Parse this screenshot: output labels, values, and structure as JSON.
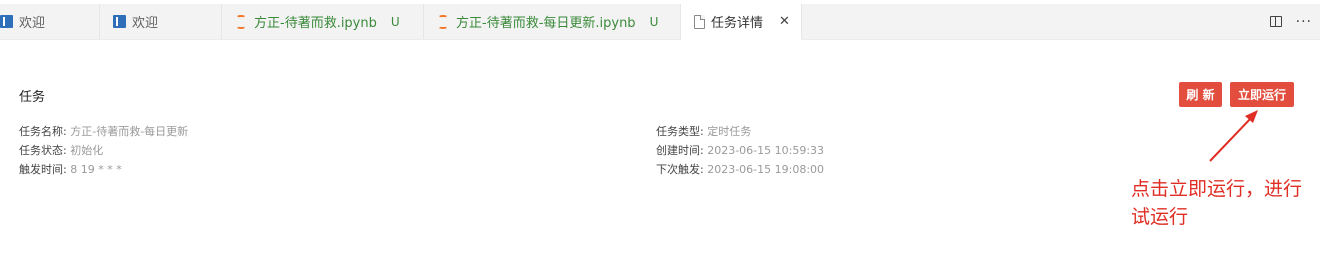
{
  "tabs": [
    {
      "label": "欢迎",
      "icon": "welcome-icon"
    },
    {
      "label": "欢迎",
      "icon": "welcome-icon"
    },
    {
      "label": "方正-待著而救.ipynb",
      "icon": "jupyter-notebook-icon",
      "status": "U"
    },
    {
      "label": "方正-待著而救-每日更新.ipynb",
      "icon": "jupyter-notebook-icon",
      "status": "U"
    },
    {
      "label": "任务详情",
      "icon": "file-icon",
      "close": "✕",
      "active": true
    }
  ],
  "editor_actions": {
    "split": "split-editor-icon",
    "more": "···"
  },
  "task": {
    "section_title": "任务",
    "refresh_label": "刷 新",
    "run_label": "立即运行",
    "name_label": "任务名称:",
    "name_value": "方正-待著而救-每日更新",
    "status_label": "任务状态:",
    "status_value": "初始化",
    "trigger_label": "触发时间:",
    "trigger_value": "8 19 * * *",
    "type_label": "任务类型:",
    "type_value": "定时任务",
    "created_label": "创建时间:",
    "created_value": "2023-06-15 10:59:33",
    "next_label": "下次触发:",
    "next_value": "2023-06-15 19:08:00"
  },
  "annotation": {
    "text": "点击立即运行，进行试运行",
    "color": "#e02e24"
  },
  "colors": {
    "button": "#e24d3d",
    "accent_green": "#3a8a3a",
    "jupyter": "#f37626"
  }
}
